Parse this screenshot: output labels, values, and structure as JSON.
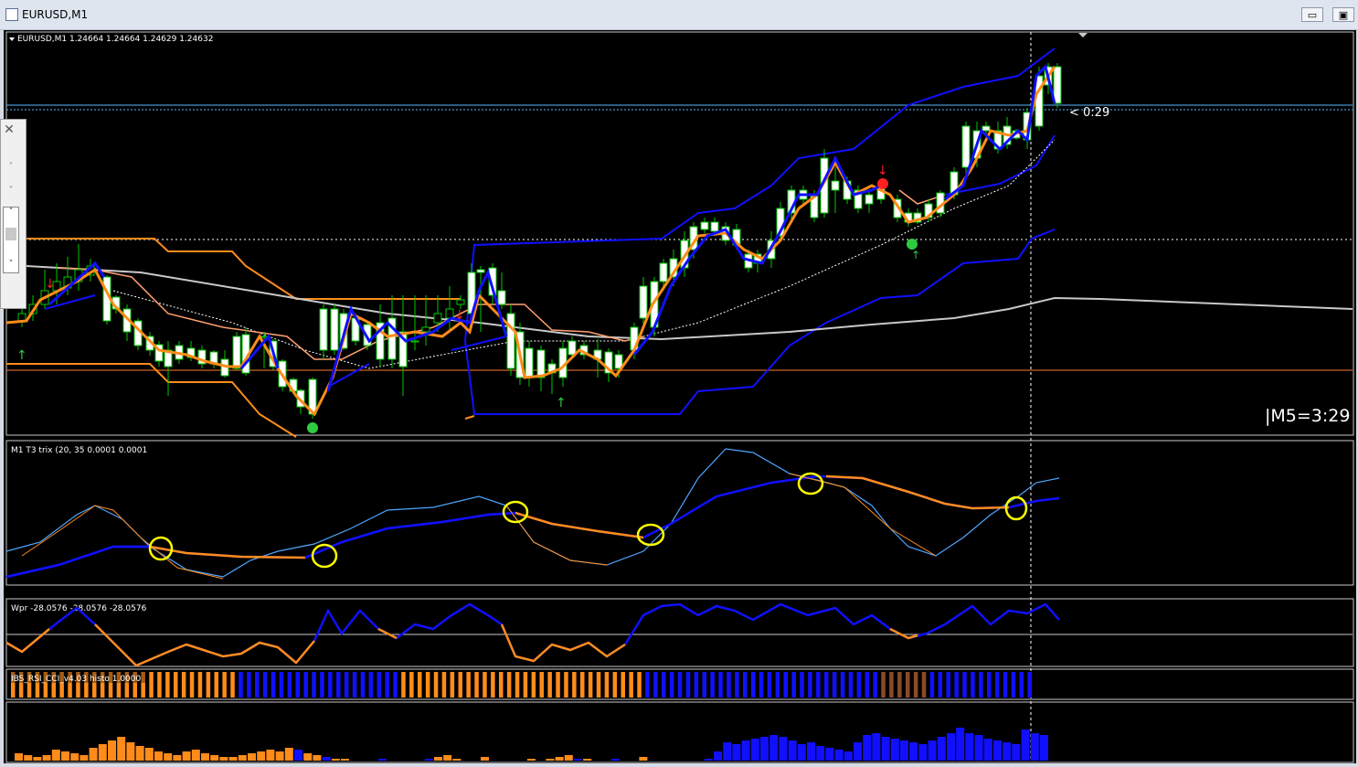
{
  "window": {
    "title": "EURUSD,M1",
    "min_label": "▭",
    "max_label": "▣"
  },
  "main_panel": {
    "header": "EURUSD,M1  1.24664 1.24664 1.24629 1.24632",
    "countdown": "< 0:29",
    "m5_timer": "|M5=3:29"
  },
  "trix_panel": {
    "header": "M1 T3 trix (20, 35 0.0001 0.0001"
  },
  "wpr_panel": {
    "header": "Wpr -28.0576 -28.0576 -28.0576"
  },
  "ibs_panel": {
    "header": "IBS_RSI_CCI_v4.03 histo 1.0000",
    "bars": [
      "o",
      "o",
      "o",
      "o",
      "o",
      "o",
      "o",
      "o",
      "o",
      "o",
      "o",
      "o",
      "o",
      "o",
      "o",
      "o",
      "o",
      "o",
      "o",
      "o",
      "o",
      "o",
      "o",
      "o",
      "o",
      "o",
      "o",
      "o",
      "b",
      "b",
      "b",
      "b",
      "b",
      "b",
      "b",
      "b",
      "b",
      "b",
      "b",
      "b",
      "b",
      "b",
      "b",
      "b",
      "b",
      "b",
      "b",
      "b",
      "o",
      "o",
      "o",
      "o",
      "o",
      "o",
      "o",
      "o",
      "o",
      "o",
      "o",
      "o",
      "o",
      "o",
      "o",
      "o",
      "o",
      "o",
      "o",
      "o",
      "o",
      "o",
      "o",
      "o",
      "o",
      "o",
      "o",
      "o",
      "o",
      "o",
      "b",
      "b",
      "b",
      "b",
      "b",
      "b",
      "b",
      "b",
      "b",
      "b",
      "b",
      "b",
      "b",
      "b",
      "b",
      "b",
      "b",
      "b",
      "b",
      "b",
      "b",
      "b",
      "b",
      "b",
      "b",
      "b",
      "b",
      "b",
      "b",
      "d",
      "d",
      "d",
      "d",
      "d",
      "d",
      "b",
      "b",
      "b",
      "b",
      "b",
      "b",
      "b",
      "b",
      "b",
      "b",
      "b",
      "b",
      "b"
    ]
  },
  "histogram_panel": {
    "bars": [
      {
        "v": 3,
        "c": "o"
      },
      {
        "v": 2,
        "c": "o"
      },
      {
        "v": 1,
        "c": "o"
      },
      {
        "v": 1,
        "c": "o"
      },
      {
        "v": 1,
        "c": "o"
      },
      {
        "v": 1,
        "c": "o"
      },
      {
        "v": 1,
        "c": "o"
      },
      {
        "v": 1,
        "c": "o"
      },
      {
        "v": 1,
        "c": "o"
      },
      {
        "v": 1,
        "c": "o"
      },
      {
        "v": 1,
        "c": "o"
      },
      {
        "v": 1,
        "c": "o"
      },
      {
        "v": 1,
        "c": "o"
      },
      {
        "v": 1,
        "c": "o"
      },
      {
        "v": 1,
        "c": "o"
      },
      {
        "v": 1,
        "c": "o"
      },
      {
        "v": 1,
        "c": "o"
      },
      {
        "v": 1,
        "c": "o"
      },
      {
        "v": 1,
        "c": "o"
      },
      {
        "v": 1,
        "c": "o"
      },
      {
        "v": 1,
        "c": "o"
      },
      {
        "v": 1,
        "c": "o"
      },
      {
        "v": 1,
        "c": "o"
      },
      {
        "v": 1,
        "c": "o"
      },
      {
        "v": 1,
        "c": "o"
      },
      {
        "v": 1,
        "c": "o"
      },
      {
        "v": 1,
        "c": "o"
      },
      {
        "v": 1,
        "c": "o"
      },
      {
        "v": 1,
        "c": "o"
      },
      {
        "v": 1,
        "c": "o"
      },
      {
        "v": 1,
        "c": "o"
      },
      {
        "v": 1,
        "c": "o"
      },
      {
        "v": 1,
        "c": "o"
      },
      {
        "v": 1,
        "c": "o"
      },
      {
        "v": 1,
        "c": "o"
      },
      {
        "v": 1,
        "c": "o"
      },
      {
        "v": 1,
        "c": "o"
      },
      {
        "v": 1,
        "c": "o"
      },
      {
        "v": 1,
        "c": "o"
      },
      {
        "v": 1,
        "c": "o"
      },
      {
        "v": 1,
        "c": "o"
      },
      {
        "v": 1,
        "c": "o"
      },
      {
        "v": 1,
        "c": "o"
      },
      {
        "v": 1,
        "c": "o"
      },
      {
        "v": 1,
        "c": "o"
      },
      {
        "v": 1,
        "c": "o"
      },
      {
        "v": 1,
        "c": "o"
      },
      {
        "v": 1,
        "c": "o"
      },
      {
        "v": 1,
        "c": "o"
      },
      {
        "v": 1,
        "c": "o"
      },
      {
        "v": 1,
        "c": "o"
      },
      {
        "v": 1,
        "c": "o"
      },
      {
        "v": 1,
        "c": "o"
      },
      {
        "v": 1,
        "c": "o"
      },
      {
        "v": 1,
        "c": "o"
      },
      {
        "v": 1,
        "c": "o"
      },
      {
        "v": 1,
        "c": "o"
      },
      {
        "v": 1,
        "c": "o"
      },
      {
        "v": 1,
        "c": "o"
      },
      {
        "v": 1,
        "c": "o"
      },
      {
        "v": 1,
        "c": "o"
      },
      {
        "v": 1,
        "c": "o"
      },
      {
        "v": 1,
        "c": "o"
      },
      {
        "v": 1,
        "c": "o"
      },
      {
        "v": 1,
        "c": "o"
      },
      {
        "v": 1,
        "c": "o"
      },
      {
        "v": 1,
        "c": "o"
      },
      {
        "v": 1,
        "c": "o"
      },
      {
        "v": 1,
        "c": "o"
      },
      {
        "v": 1,
        "c": "o"
      },
      {
        "v": 1,
        "c": "o"
      },
      {
        "v": 1,
        "c": "o"
      },
      {
        "v": 1,
        "c": "o"
      },
      {
        "v": 1,
        "c": "o"
      },
      {
        "v": 1,
        "c": "o"
      },
      {
        "v": 1,
        "c": "o"
      },
      {
        "v": 1,
        "c": "o"
      },
      {
        "v": 1,
        "c": "o"
      },
      {
        "v": 1,
        "c": "o"
      },
      {
        "v": 1,
        "c": "o"
      },
      {
        "v": 1,
        "c": "o"
      },
      {
        "v": 1,
        "c": "o"
      },
      {
        "v": 1,
        "c": "o"
      },
      {
        "v": 1,
        "c": "o"
      },
      {
        "v": 1,
        "c": "o"
      },
      {
        "v": 1,
        "c": "o"
      },
      {
        "v": 1,
        "c": "o"
      },
      {
        "v": 1,
        "c": "o"
      },
      {
        "v": 1,
        "c": "o"
      },
      {
        "v": 1,
        "c": "o"
      }
    ]
  },
  "colors": {
    "background": "#000000",
    "bull_candle": "#00c800",
    "bear_body": "#ffffff",
    "orange": "#ff8c1a",
    "blue": "#1010ff",
    "light_blue": "#4da6ff",
    "salmon": "#ffa070",
    "gray_ma": "#c8c8c8",
    "yellow_marker": "#ffff00",
    "hline": "#59b7ff",
    "window_frame": "#dfe5ef"
  },
  "icons": {
    "window": "chart-window-icon",
    "close": "close-icon",
    "scroll_up": "chevron-up-icon",
    "scroll_down": "chevron-down-icon"
  }
}
